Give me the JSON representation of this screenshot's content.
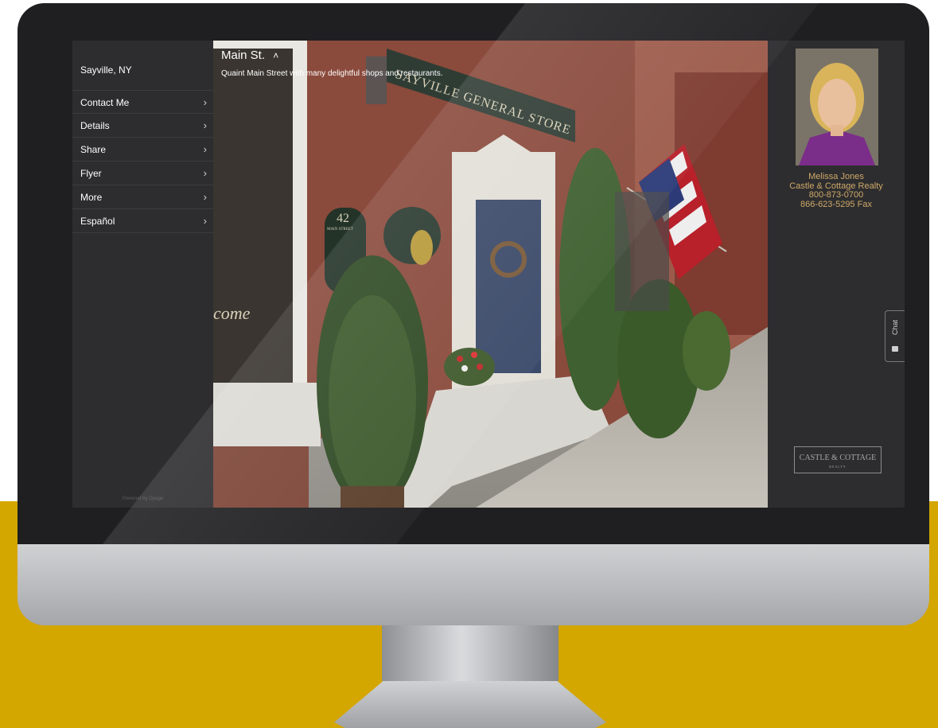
{
  "sidebar": {
    "location": "Sayville, NY",
    "items": [
      {
        "label": "Contact Me"
      },
      {
        "label": "Details"
      },
      {
        "label": "Share"
      },
      {
        "label": "Flyer"
      },
      {
        "label": "More"
      },
      {
        "label": "Español"
      }
    ],
    "powered_by": "Powered by Opage"
  },
  "photo": {
    "title": "Main St.",
    "caption": "Quaint Main Street with many delightful shops and restaurants.",
    "store_sign": "SAYVILLE GENERAL STORE",
    "plaque_number": "42",
    "plaque_street": "MAIN STREET",
    "window_text": "come"
  },
  "agent": {
    "name": "Melissa Jones",
    "company": "Castle & Cottage Realty",
    "phone": "800-873-0700",
    "fax": "866-623-5295 Fax"
  },
  "chat": {
    "label": "Chat"
  },
  "logo": {
    "text": "CASTLE & COTTAGE",
    "subtext": "REALTY"
  },
  "colors": {
    "gold_band": "#d4a600",
    "agent_text": "#cfa968",
    "panel_bg": "#2d2d2f"
  }
}
